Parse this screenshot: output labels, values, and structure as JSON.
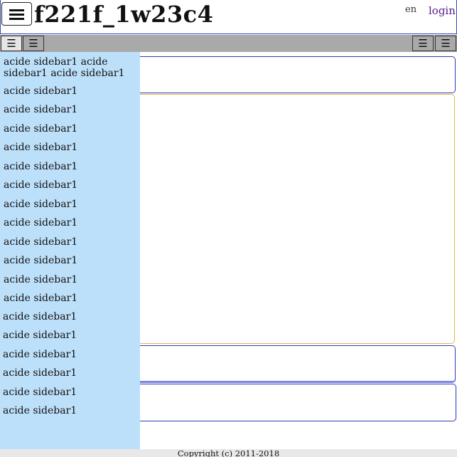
{
  "header": {
    "site_title": "f221f_1w23c4",
    "language_alt": "en",
    "login_label": "login"
  },
  "icons": {
    "menu": "hamburger-menu-icon",
    "align_left": "align-left-icon",
    "align_justify": "align-justify-icon",
    "align_right": "align-right-icon"
  },
  "toolbar": {
    "btn1": "☰",
    "btn2": "☰",
    "btn3": "☰",
    "btn4": "☰"
  },
  "sidebar": {
    "items": [
      "acide sidebar1 acide sidebar1 acide sidebar1",
      "acide sidebar1",
      "acide sidebar1",
      "acide sidebar1",
      "acide sidebar1",
      "acide sidebar1",
      "acide sidebar1",
      "acide sidebar1",
      "acide sidebar1",
      "acide sidebar1",
      "acide sidebar1",
      "acide sidebar1",
      "acide sidebar1",
      "acide sidebar1",
      "acide sidebar1",
      "acide sidebar1",
      "acide sidebar1",
      "acide sidebar1",
      "acide sidebar1"
    ]
  },
  "footer": {
    "copyright": "Copyright (c) 2011-2018"
  }
}
